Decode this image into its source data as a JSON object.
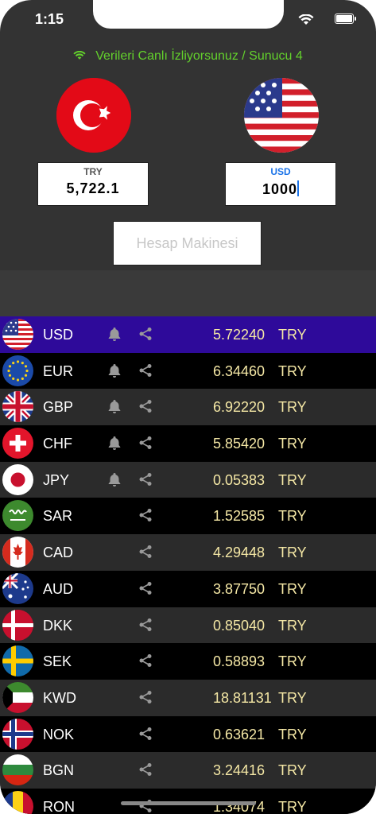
{
  "status": {
    "time": "1:15"
  },
  "header": {
    "live_text": "Verileri Canlı İzliyorsunuz / Sunucu 4"
  },
  "converter": {
    "from": {
      "code": "TRY",
      "value": "5,722.1"
    },
    "to": {
      "code": "USD",
      "value": "1000"
    },
    "calculator_label": "Hesap Makinesi"
  },
  "rates": [
    {
      "code": "USD",
      "rate": "5.72240",
      "unit": "TRY",
      "bell": true
    },
    {
      "code": "EUR",
      "rate": "6.34460",
      "unit": "TRY",
      "bell": true
    },
    {
      "code": "GBP",
      "rate": "6.92220",
      "unit": "TRY",
      "bell": true
    },
    {
      "code": "CHF",
      "rate": "5.85420",
      "unit": "TRY",
      "bell": true
    },
    {
      "code": "JPY",
      "rate": "0.05383",
      "unit": "TRY",
      "bell": true
    },
    {
      "code": "SAR",
      "rate": "1.52585",
      "unit": "TRY",
      "bell": false
    },
    {
      "code": "CAD",
      "rate": "4.29448",
      "unit": "TRY",
      "bell": false
    },
    {
      "code": "AUD",
      "rate": "3.87750",
      "unit": "TRY",
      "bell": false
    },
    {
      "code": "DKK",
      "rate": "0.85040",
      "unit": "TRY",
      "bell": false
    },
    {
      "code": "SEK",
      "rate": "0.58893",
      "unit": "TRY",
      "bell": false
    },
    {
      "code": "KWD",
      "rate": "18.81131",
      "unit": "TRY",
      "bell": false
    },
    {
      "code": "NOK",
      "rate": "0.63621",
      "unit": "TRY",
      "bell": false
    },
    {
      "code": "BGN",
      "rate": "3.24416",
      "unit": "TRY",
      "bell": false
    },
    {
      "code": "RON",
      "rate": "1.34074",
      "unit": "TRY",
      "bell": false
    }
  ],
  "colors": {
    "live": "#63d12c",
    "rate_text": "#f4e7a5",
    "selected_row": "#2e0a9a"
  }
}
